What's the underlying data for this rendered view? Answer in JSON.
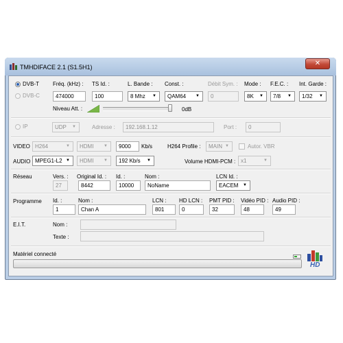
{
  "window": {
    "title": "TMHDIFACE 2.1 (S1.5H1)",
    "close_glyph": "✕"
  },
  "tuner": {
    "dvbt_label": "DVB-T",
    "dvbc_label": "DVB-C",
    "freq_label": "Fréq. (kHz) :",
    "freq_value": "474000",
    "tsid_label": "TS Id. :",
    "tsid_value": "100",
    "bande_label": "L. Bande :",
    "bande_value": "8 Mhz",
    "const_label": "Const. :",
    "const_value": "QAM64",
    "debit_label": "Débit Sym. :",
    "debit_value": "0",
    "mode_label": "Mode :",
    "mode_value": "8K",
    "fec_label": "F.E.C. :",
    "fec_value": "7/8",
    "garde_label": "Int. Garde :",
    "garde_value": "1/32",
    "niveau_label": "Niveau Att. :",
    "niveau_value": "0dB",
    "niveau_level": 1.0
  },
  "ip": {
    "ip_label": "IP",
    "protocol_value": "UDP",
    "adresse_label": "Adresse :",
    "adresse_value": "192.168.1.12",
    "port_label": "Port :",
    "port_value": "0"
  },
  "video": {
    "label": "VIDEO",
    "codec_value": "H264",
    "source_value": "HDMI",
    "bitrate_value": "9000",
    "bitrate_unit": "Kb/s",
    "profile_label": "H264 Profile :",
    "profile_value": "MAIN",
    "autor_vbr_label": "Autor. VBR"
  },
  "audio": {
    "label": "AUDIO",
    "codec_value": "MPEG1-L2",
    "source_value": "HDMI",
    "bitrate_value": "192 Kb/s",
    "volume_label": "Volume HDMI-PCM :",
    "volume_value": "x1"
  },
  "reseau": {
    "label": "Réseau",
    "vers_label": "Vers. :",
    "vers_value": "27",
    "orig_label": "Original Id. :",
    "orig_value": "8442",
    "id_label": "Id. :",
    "id_value": "10000",
    "nom_label": "Nom :",
    "nom_value": "NoName",
    "lcnid_label": "LCN Id. :",
    "lcnid_value": "EACEM"
  },
  "programme": {
    "label": "Programme",
    "id_label": "Id. :",
    "id_value": "1",
    "nom_label": "Nom :",
    "nom_value": "Chan A",
    "lcn_label": "LCN :",
    "lcn_value": "801",
    "hdlcn_label": "HD LCN :",
    "hdlcn_value": "0",
    "pmt_label": "PMT PID :",
    "pmt_value": "32",
    "video_pid_label": "Vidéo PID :",
    "video_pid_value": "48",
    "audio_pid_label": "Audio PID :",
    "audio_pid_value": "49"
  },
  "eit": {
    "label": "E.I.T.",
    "nom_label": "Nom :",
    "nom_value": "",
    "texte_label": "Texte :",
    "texte_value": ""
  },
  "status": {
    "text": "Matériel connecté",
    "progress": 0,
    "logo_text": "HD"
  }
}
